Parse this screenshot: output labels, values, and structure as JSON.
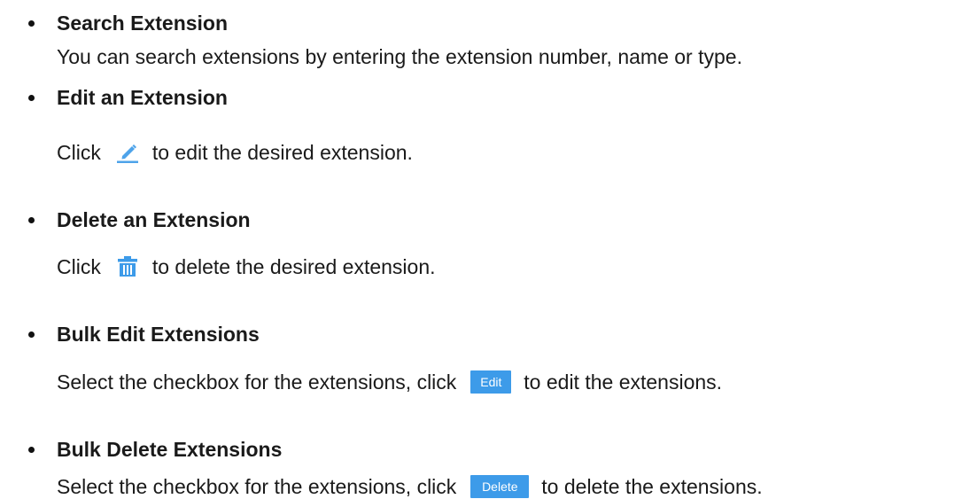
{
  "items": [
    {
      "heading": "Search Extension",
      "description": "You can search extensions by entering the extension number, name or type."
    },
    {
      "heading": "Edit an Extension",
      "desc_before": "Click",
      "icon": "pencil-icon",
      "desc_after": "to edit the desired extension."
    },
    {
      "heading": "Delete an Extension",
      "desc_before": "Click",
      "icon": "trash-icon",
      "desc_after": "to delete the desired extension."
    },
    {
      "heading": "Bulk Edit Extensions",
      "desc_before": "Select the checkbox for the extensions, click",
      "button_label": "Edit",
      "desc_after": "to edit the extensions."
    },
    {
      "heading": "Bulk Delete Extensions",
      "desc_before": "Select the checkbox for the extensions, click",
      "button_label": "Delete",
      "desc_after": "to delete the extensions."
    }
  ],
  "colors": {
    "accent": "#3d9be9",
    "text": "#1a1a1a"
  }
}
